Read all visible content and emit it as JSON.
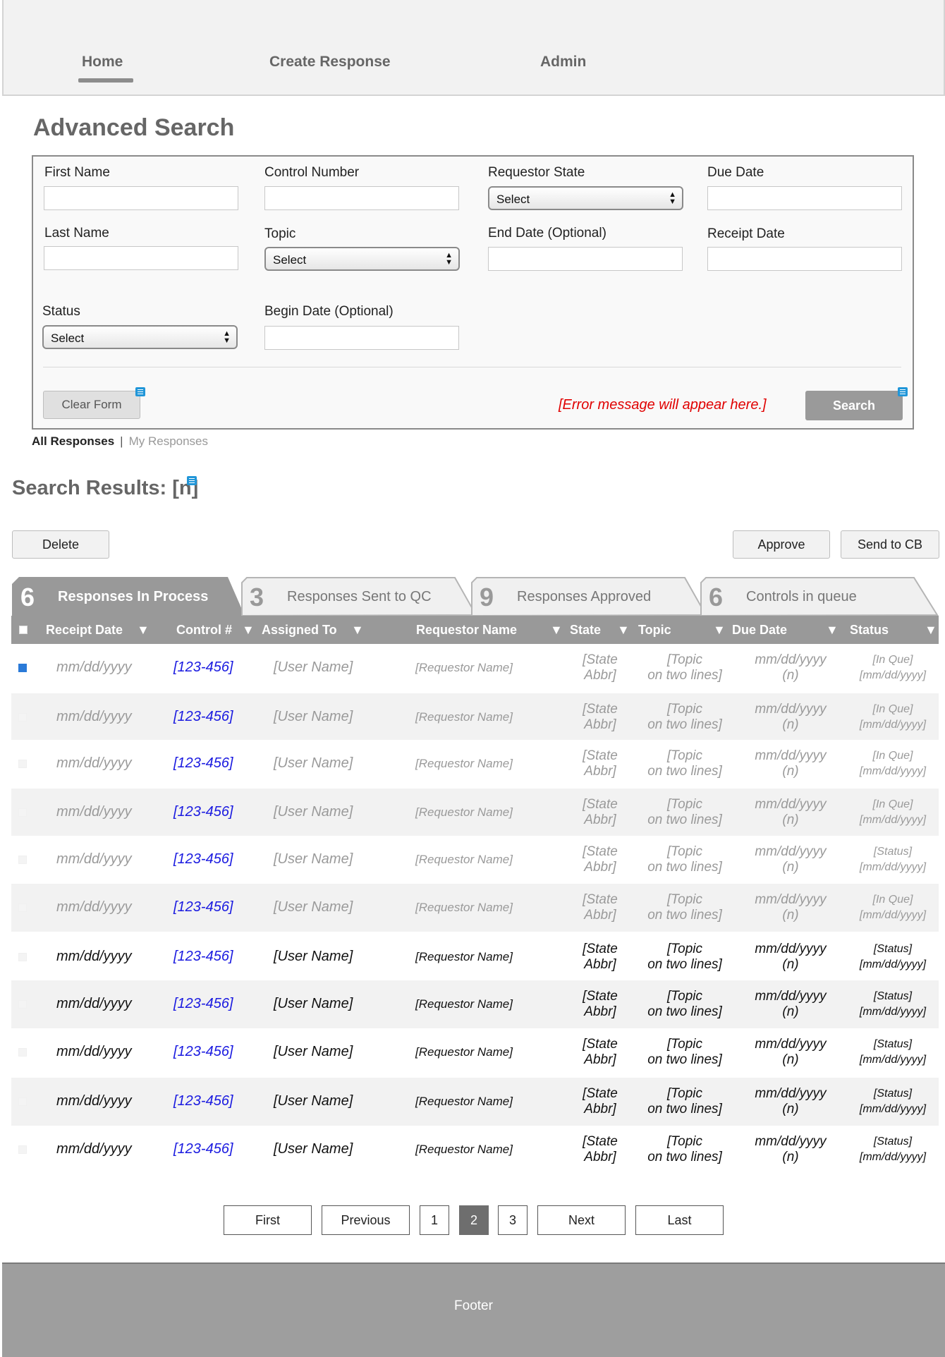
{
  "nav": {
    "items": [
      "Home",
      "Create Response",
      "Admin"
    ],
    "active": "Home"
  },
  "advanced_search": {
    "title": "Advanced Search",
    "fields": {
      "first_name": {
        "label": "First Name",
        "value": ""
      },
      "control_number": {
        "label": "Control Number",
        "value": ""
      },
      "requestor_state": {
        "label": "Requestor State",
        "selected": "Select"
      },
      "due_date": {
        "label": "Due Date",
        "value": ""
      },
      "last_name": {
        "label": "Last Name",
        "value": ""
      },
      "topic": {
        "label": "Topic",
        "selected": "Select"
      },
      "end_date": {
        "label": "End Date (Optional)",
        "value": ""
      },
      "receipt_date": {
        "label": "Receipt Date",
        "value": ""
      },
      "status": {
        "label": "Status",
        "selected": "Select"
      },
      "begin_date": {
        "label": "Begin Date (Optional)",
        "value": ""
      }
    },
    "clear_label": "Clear Form",
    "search_label": "Search",
    "error_message": "[Error message will appear here.]"
  },
  "response_filter": {
    "all": "All Responses",
    "separator": "|",
    "mine": "My Responses"
  },
  "results": {
    "title": "Search Results: [n]",
    "delete_label": "Delete",
    "approve_label": "Approve",
    "send_label": "Send to CB"
  },
  "tabs": [
    {
      "count": "6",
      "label": "Responses In Process",
      "active": true
    },
    {
      "count": "3",
      "label": "Responses Sent to QC",
      "active": false
    },
    {
      "count": "9",
      "label": "Responses Approved",
      "active": false
    },
    {
      "count": "6",
      "label": "Controls in queue",
      "active": false
    }
  ],
  "table": {
    "columns": [
      "Receipt Date",
      "Control #",
      "Assigned To",
      "Requestor Name",
      "State",
      "Topic",
      "Due Date",
      "Status"
    ],
    "rows": [
      {
        "date": "mm/dd/yyyy",
        "control": "[123-456]",
        "user": "[User Name]",
        "requestor": "[Requestor Name]",
        "state1": "[State",
        "state2": "Abbr]",
        "topic1": "[Topic",
        "topic2": "on two lines]",
        "due1": "mm/dd/yyyy",
        "due2": "(n)",
        "status1": "[In Que]",
        "status2": "[mm/dd/yyyy]",
        "checked": true,
        "dim": true
      },
      {
        "date": "mm/dd/yyyy",
        "control": "[123-456]",
        "user": "[User Name]",
        "requestor": "[Requestor Name]",
        "state1": "[State",
        "state2": "Abbr]",
        "topic1": "[Topic",
        "topic2": "on two lines]",
        "due1": "mm/dd/yyyy",
        "due2": "(n)",
        "status1": "[In Que]",
        "status2": "[mm/dd/yyyy]",
        "checked": false,
        "dim": true
      },
      {
        "date": "mm/dd/yyyy",
        "control": "[123-456]",
        "user": "[User Name]",
        "requestor": "[Requestor Name]",
        "state1": "[State",
        "state2": "Abbr]",
        "topic1": "[Topic",
        "topic2": "on two lines]",
        "due1": "mm/dd/yyyy",
        "due2": "(n)",
        "status1": "[In Que]",
        "status2": "[mm/dd/yyyy]",
        "checked": false,
        "dim": true
      },
      {
        "date": "mm/dd/yyyy",
        "control": "[123-456]",
        "user": "[User Name]",
        "requestor": "[Requestor Name]",
        "state1": "[State",
        "state2": "Abbr]",
        "topic1": "[Topic",
        "topic2": "on two lines]",
        "due1": "mm/dd/yyyy",
        "due2": "(n)",
        "status1": "[In Que]",
        "status2": "[mm/dd/yyyy]",
        "checked": false,
        "dim": true
      },
      {
        "date": "mm/dd/yyyy",
        "control": "[123-456]",
        "user": "[User Name]",
        "requestor": "[Requestor Name]",
        "state1": "[State",
        "state2": "Abbr]",
        "topic1": "[Topic",
        "topic2": "on two lines]",
        "due1": "mm/dd/yyyy",
        "due2": "(n)",
        "status1": "[Status]",
        "status2": "[mm/dd/yyyy]",
        "checked": false,
        "dim": true
      },
      {
        "date": "mm/dd/yyyy",
        "control": "[123-456]",
        "user": "[User Name]",
        "requestor": "[Requestor Name]",
        "state1": "[State",
        "state2": "Abbr]",
        "topic1": "[Topic",
        "topic2": "on two lines]",
        "due1": "mm/dd/yyyy",
        "due2": "(n)",
        "status1": "[In Que]",
        "status2": "[mm/dd/yyyy]",
        "checked": false,
        "dim": true
      },
      {
        "date": "mm/dd/yyyy",
        "control": "[123-456]",
        "user": "[User Name]",
        "requestor": "[Requestor Name]",
        "state1": "[State",
        "state2": "Abbr]",
        "topic1": "[Topic",
        "topic2": "on two lines]",
        "due1": "mm/dd/yyyy",
        "due2": "(n)",
        "status1": "[Status]",
        "status2": "[mm/dd/yyyy]",
        "checked": false,
        "dim": false
      },
      {
        "date": "mm/dd/yyyy",
        "control": "[123-456]",
        "user": "[User Name]",
        "requestor": "[Requestor Name]",
        "state1": "[State",
        "state2": "Abbr]",
        "topic1": "[Topic",
        "topic2": "on two lines]",
        "due1": "mm/dd/yyyy",
        "due2": "(n)",
        "status1": "[Status]",
        "status2": "[mm/dd/yyyy]",
        "checked": false,
        "dim": false
      },
      {
        "date": "mm/dd/yyyy",
        "control": "[123-456]",
        "user": "[User Name]",
        "requestor": "[Requestor Name]",
        "state1": "[State",
        "state2": "Abbr]",
        "topic1": "[Topic",
        "topic2": "on two lines]",
        "due1": "mm/dd/yyyy",
        "due2": "(n)",
        "status1": "[Status]",
        "status2": "[mm/dd/yyyy]",
        "checked": false,
        "dim": false
      },
      {
        "date": "mm/dd/yyyy",
        "control": "[123-456]",
        "user": "[User Name]",
        "requestor": "[Requestor Name]",
        "state1": "[State",
        "state2": "Abbr]",
        "topic1": "[Topic",
        "topic2": "on two lines]",
        "due1": "mm/dd/yyyy",
        "due2": "(n)",
        "status1": "[Status]",
        "status2": "[mm/dd/yyyy]",
        "checked": false,
        "dim": false
      },
      {
        "date": "mm/dd/yyyy",
        "control": "[123-456]",
        "user": "[User Name]",
        "requestor": "[Requestor Name]",
        "state1": "[State",
        "state2": "Abbr]",
        "topic1": "[Topic",
        "topic2": "on two lines]",
        "due1": "mm/dd/yyyy",
        "due2": "(n)",
        "status1": "[Status]",
        "status2": "[mm/dd/yyyy]",
        "checked": false,
        "dim": false
      }
    ]
  },
  "pagination": {
    "first": "First",
    "previous": "Previous",
    "pages": [
      "1",
      "2",
      "3"
    ],
    "current": "2",
    "next": "Next",
    "last": "Last"
  },
  "footer": {
    "text": "Footer"
  },
  "colors": {
    "error": "#e00000",
    "link": "#1a1ae0",
    "header_bar": "#999999",
    "active_tab": "#999999",
    "search_button": "#9a9a9a"
  },
  "icons": {
    "note": "note-icon",
    "sort": "sort-down-icon",
    "select_arrows": "select-arrows-icon"
  }
}
